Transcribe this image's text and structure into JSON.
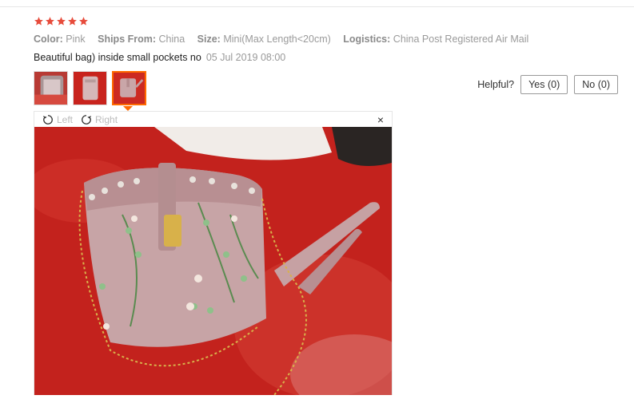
{
  "review": {
    "rating": 5,
    "attributes": [
      {
        "key": "Color:",
        "value": "Pink"
      },
      {
        "key": "Ships From:",
        "value": "China"
      },
      {
        "key": "Size:",
        "value": "Mini(Max Length<20cm)"
      },
      {
        "key": "Logistics:",
        "value": "China Post Registered Air Mail"
      }
    ],
    "text": "Beautiful bag) inside small pockets no",
    "date": "05 Jul 2019 08:00"
  },
  "thumbnails": [
    "thumbnail-1",
    "thumbnail-2",
    "thumbnail-3"
  ],
  "helpful": {
    "label": "Helpful?",
    "yes_label": "Yes (0)",
    "no_label": "No (0)"
  },
  "viewer": {
    "left_label": "Left",
    "right_label": "Right",
    "close_label": "×"
  },
  "colors": {
    "star": "#e74c3c",
    "accent": "#ff6a00",
    "bag": "#c9a6a8",
    "background_cloth": "#c9241f"
  }
}
